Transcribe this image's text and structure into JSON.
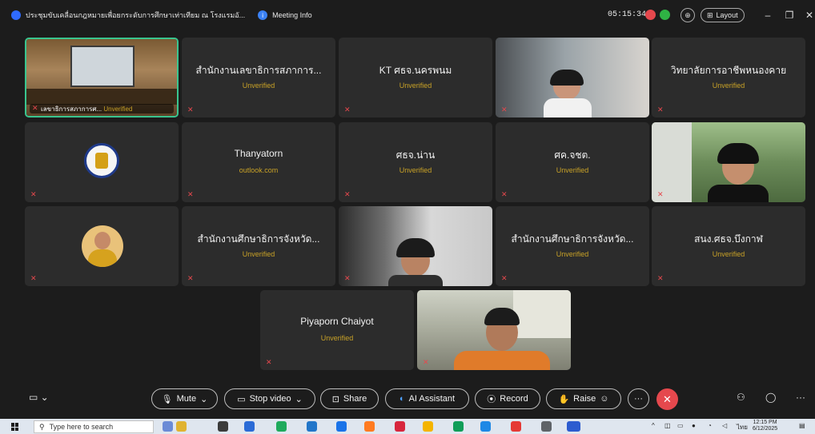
{
  "titlebar": {
    "title": "ประชุมขับเคลื่อนกฎหมายเพื่อยกระดับการศึกษาเท่าเทียม ณ โรงแรมอั...",
    "meeting_info": "Meeting Info",
    "timer": "05:15:34",
    "layout_label": "Layout"
  },
  "tiles": [
    {
      "name": "เลขาธิการสภาการศ...",
      "sub": "Unverified",
      "type": "video-room"
    },
    {
      "name": "สำนักงานเลขาธิการสภาการ...",
      "sub": "Unverified",
      "type": "name"
    },
    {
      "name": "KT ศธจ.นครพนม",
      "sub": "Unverified",
      "type": "name"
    },
    {
      "name": "",
      "sub": "",
      "type": "video-woman"
    },
    {
      "name": "วิทยาลัยการอาชีพหนองคาย",
      "sub": "Unverified",
      "type": "name"
    },
    {
      "name": "",
      "sub": "",
      "type": "logo"
    },
    {
      "name": "Thanyatorn",
      "sub": "outlook.com",
      "type": "name"
    },
    {
      "name": "ศธจ.น่าน",
      "sub": "Unverified",
      "type": "name"
    },
    {
      "name": "ศค.จชต.",
      "sub": "Unverified",
      "type": "name"
    },
    {
      "name": "",
      "sub": "",
      "type": "video-outdoor"
    },
    {
      "name": "",
      "sub": "",
      "type": "avatar"
    },
    {
      "name": "สำนักงานศึกษาธิการจังหวัด...",
      "sub": "Unverified",
      "type": "name"
    },
    {
      "name": "",
      "sub": "",
      "type": "video-headset"
    },
    {
      "name": "สำนักงานศึกษาธิการจังหวัด...",
      "sub": "Unverified",
      "type": "name"
    },
    {
      "name": "สนง.ศธจ.บึงกาฬ",
      "sub": "Unverified",
      "type": "name"
    },
    {
      "name": "Piyaporn Chaiyot",
      "sub": "Unverified",
      "type": "name"
    },
    {
      "name": "",
      "sub": "",
      "type": "video-man"
    }
  ],
  "toolbar": {
    "mute": "Mute",
    "stop_video": "Stop video",
    "share": "Share",
    "ai_assistant": "AI Assistant",
    "record": "Record",
    "raise": "Raise"
  },
  "taskbar": {
    "search_placeholder": "Type here to search",
    "time": "12:15 PM",
    "date": "6/12/2025"
  },
  "colors": {
    "background": "#1c1c1c",
    "tile": "#2c2c2c",
    "active_border": "#39c58f",
    "unverified": "#c9a227",
    "end_call": "#e5484d"
  }
}
